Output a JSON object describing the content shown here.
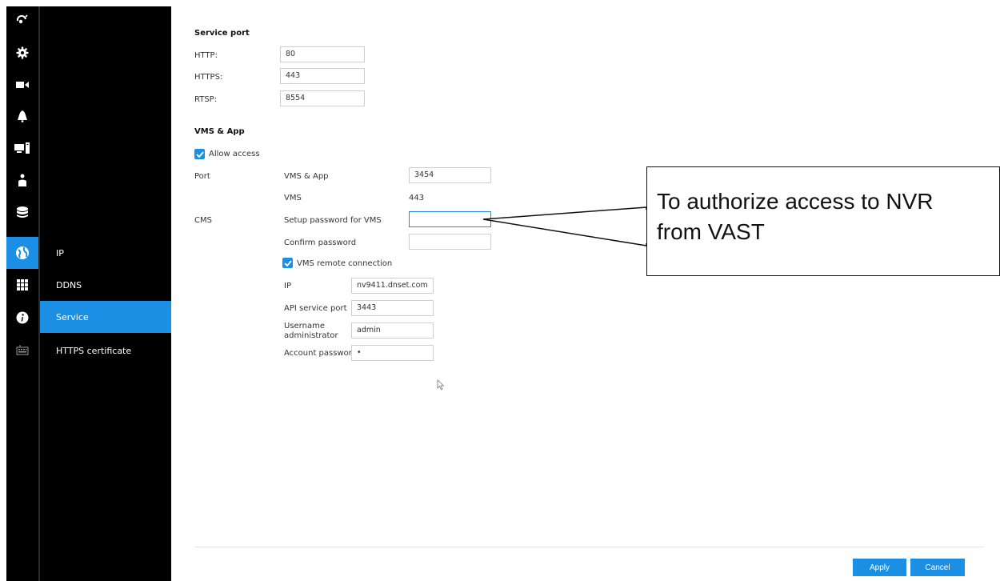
{
  "sidebar": {
    "icons": [
      {
        "name": "live-view-icon"
      },
      {
        "name": "settings-gear-icon"
      },
      {
        "name": "camera-icon"
      },
      {
        "name": "alarm-bell-icon"
      },
      {
        "name": "system-monitor-icon"
      },
      {
        "name": "user-icon"
      },
      {
        "name": "storage-icon"
      },
      {
        "name": "network-globe-icon",
        "active": true
      },
      {
        "name": "apps-grid-icon"
      },
      {
        "name": "info-icon"
      },
      {
        "name": "keyboard-icon"
      }
    ],
    "subnav": [
      {
        "label": "IP"
      },
      {
        "label": "DDNS"
      },
      {
        "label": "Service",
        "active": true
      },
      {
        "label": "HTTPS certificate"
      }
    ]
  },
  "service_port": {
    "title": "Service port",
    "http_label": "HTTP:",
    "http_value": "80",
    "https_label": "HTTPS:",
    "https_value": "443",
    "rtsp_label": "RTSP:",
    "rtsp_value": "8554"
  },
  "vms_app": {
    "title": "VMS & App",
    "allow_access_label": "Allow access",
    "allow_access_checked": true,
    "port_label": "Port",
    "vms_app_label": "VMS & App",
    "vms_app_value": "3454",
    "vms_label": "VMS",
    "vms_value": "443",
    "cms_label": "CMS",
    "setup_password_label": "Setup password for VMS",
    "setup_password_value": "",
    "confirm_password_label": "Confirm password",
    "confirm_password_value": "",
    "remote_connection_label": "VMS remote connection",
    "remote_connection_checked": true,
    "ip_label": "IP",
    "ip_value": "nv9411.dnset.com",
    "api_port_label": "API service port",
    "api_port_value": "3443",
    "username_label_1": "Username",
    "username_label_2": "administrator",
    "username_value": "admin",
    "account_password_label": "Account password",
    "account_password_value": "•"
  },
  "footer": {
    "apply_label": "Apply",
    "cancel_label": "Cancel"
  },
  "callout": {
    "line1": "To authorize access to NVR",
    "line2": "from VAST"
  },
  "colors": {
    "accent": "#1a8fe3",
    "sidebar_bg": "#000000"
  }
}
